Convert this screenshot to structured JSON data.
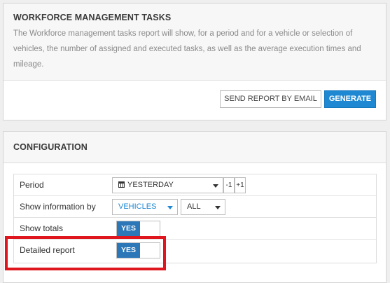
{
  "report": {
    "title": "WORKFORCE MANAGEMENT TASKS",
    "description": "The Workforce management tasks report will show, for a period and for a vehicle or selection of vehicles, the number of assigned and executed tasks, as well as the average execution times and mileage.",
    "send_email_label": "SEND REPORT BY EMAIL",
    "generate_label": "GENERATE"
  },
  "config": {
    "title": "CONFIGURATION",
    "period": {
      "label": "Period",
      "value": "YESTERDAY",
      "minus": "-1",
      "plus": "+1",
      "icon": "calendar-icon"
    },
    "show_info": {
      "label": "Show information by",
      "value": "VEHICLES",
      "filter": "ALL"
    },
    "show_totals": {
      "label": "Show totals",
      "state": "YES"
    },
    "detailed_report": {
      "label": "Detailed report",
      "state": "YES"
    }
  },
  "colors": {
    "primary": "#1e88d3",
    "toggle_on": "#2b77b8",
    "highlight": "#e0161e"
  }
}
